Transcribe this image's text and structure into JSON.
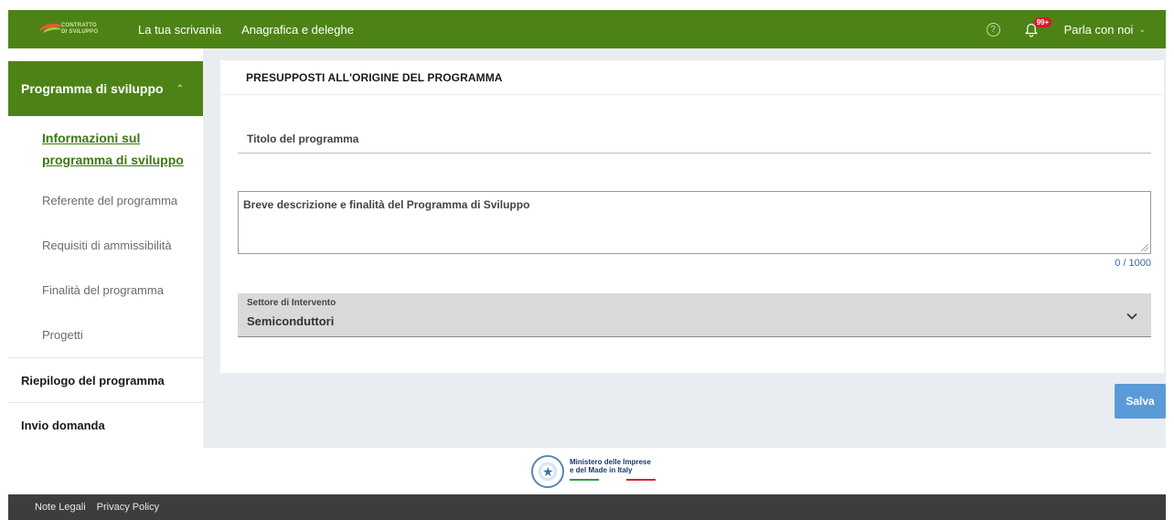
{
  "header": {
    "logo_line1": "CONTRATTO",
    "logo_line2": "DI SVILUPPO",
    "nav": [
      "La tua scrivania",
      "Anagrafica e deleghe"
    ],
    "help_icon": "question-circle-icon",
    "notification_badge": "99+",
    "contact_label": "Parla con noi",
    "brand_color": "#4d8316"
  },
  "sidebar": {
    "active_section": "Programma di sviluppo",
    "sub_items": [
      "Informazioni sul programma di sviluppo",
      "Referente del programma",
      "Requisiti di ammissibilità",
      "Finalità del programma",
      "Progetti"
    ],
    "main_items": [
      "Riepilogo del programma",
      "Invio domanda"
    ]
  },
  "form": {
    "section_title": "PRESUPPOSTI ALL'ORIGINE DEL PROGRAMMA",
    "title_placeholder": "Titolo del programma",
    "description_placeholder": "Breve descrizione e finalità del Programma di Sviluppo",
    "char_counter": "0 / 1000",
    "sector_label": "Settore di Intervento",
    "sector_value": "Semiconduttori",
    "save_label": "Salva",
    "save_color": "#5b9ad8"
  },
  "ministry": {
    "line1": "Ministero delle Imprese",
    "line2": "e del Made in Italy"
  },
  "footer": {
    "links": [
      "Note Legali",
      "Privacy Policy"
    ]
  }
}
